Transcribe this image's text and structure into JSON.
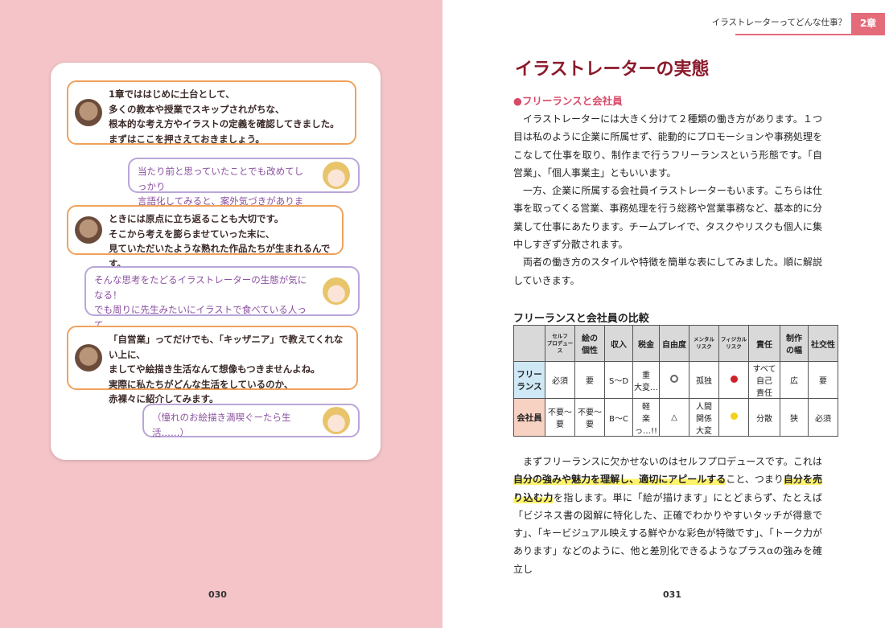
{
  "left": {
    "page_number": "030",
    "dialogue": [
      {
        "speaker": "teacher",
        "text": "1章でははじめに土台として、\n多くの教本や授業でスキップされがちな、\n根本的な考え方やイラストの定義を確認してきました。\nまずはここを押さえておきましょう。"
      },
      {
        "speaker": "student",
        "text": "当たり前と思っていたことでも改めてしっかり\n言語化してみると、案外気づきがありました。"
      },
      {
        "speaker": "teacher",
        "text": "ときには原点に立ち返ることも大切です。\nそこから考えを膨らませていった末に、\n見ていただいたような熟れた作品たちが生まれるんです。"
      },
      {
        "speaker": "student",
        "text": "そんな思考をたどるイラストレーターの生態が気になる！\nでも周りに先生みたいにイラストで食べている人って\n見かけないから、未知の生き物感があるなぁ…。"
      },
      {
        "speaker": "teacher",
        "text": "「自営業」ってだけでも、「キッザニア」で教えてくれない上に、\nましてや絵描き生活なんて想像もつきませんよね。\n実際に私たちがどんな生活をしているのか、\n赤裸々に紹介してみます。"
      },
      {
        "speaker": "student",
        "text": "（憧れのお絵描き満喫ぐーたら生活……）"
      }
    ]
  },
  "right": {
    "header_text": "イラストレーターってどんな仕事？",
    "chapter_tab": "2章",
    "title": "イラストレーターの実態",
    "section_heading": "●フリーランスと会社員",
    "paragraphs": [
      "イラストレーターには大きく分けて２種類の働き方があります。１つ目は私のように企業に所属せず、能動的にプロモーションや事務処理をこなして仕事を取り、制作まで行うフリーランスという形態です。「自営業」、「個人事業主」ともいいます。",
      "一方、企業に所属する会社員イラストレーターもいます。こちらは仕事を取ってくる営業、事務処理を行う総務や営業事務など、基本的に分業して仕事にあたります。チームプレイで、タスクやリスクも個人に集中しすぎず分散されます。",
      "両者の働き方のスタイルや特徴を簡単な表にしてみました。順に解説していきます。"
    ],
    "table_title": "フリーランスと会社員の比較",
    "table": {
      "headers": [
        "",
        "セルフ\nプロデュース",
        "絵の\n個性",
        "収入",
        "税金",
        "自由度",
        "メンタル\nリスク",
        "フィジカル\nリスク",
        "責任",
        "制作\nの幅",
        "社交性"
      ],
      "rows": [
        {
          "label": "フリー\nランス",
          "cells": [
            "必須",
            "要",
            "S〜D",
            "重\n大変…",
            "ring",
            "孤独",
            "red-dot",
            "すべて\n自己\n責任",
            "広",
            "要"
          ]
        },
        {
          "label": "会社員",
          "cells": [
            "不要〜\n要",
            "不要〜\n要",
            "B〜C",
            "軽\n楽っ…!!",
            "△",
            "人間\n関係\n大変",
            "yellow-dot",
            "分散",
            "狭",
            "必須"
          ]
        }
      ],
      "colors": {
        "header_bg": "#d9d9d9",
        "freelance_bg": "#cfe8f6",
        "employee_bg": "#f7d2c3",
        "red": "#d0202a",
        "yellow": "#f3d21b"
      }
    },
    "after_table": {
      "t1": "まずフリーランスに欠かせないのはセルフプロデュースです。これは",
      "h1": "自分の強みや魅力を理解し、適切にアピールする",
      "t2": "こと、つまり",
      "h2": "自分を売り込む力",
      "t3": "を指します。単に「絵が描けます」にとどまらず、たとえば「ビジネス書の図解に特化した、正確でわかりやすいタッチが得意です」、「キービジュアル映えする鮮やかな彩色が特徴です」、「トーク力があります」などのように、他と差別化できるようなプラスαの強みを確立し"
    },
    "page_number": "031"
  },
  "colors": {
    "left_page_bg": "#f4c4c8",
    "accent": "#e36b7a",
    "title": "#8b1a2b",
    "teacher_border": "#f0a25b",
    "student_border": "#b9a6d8",
    "student_text": "#8a4f9f"
  }
}
